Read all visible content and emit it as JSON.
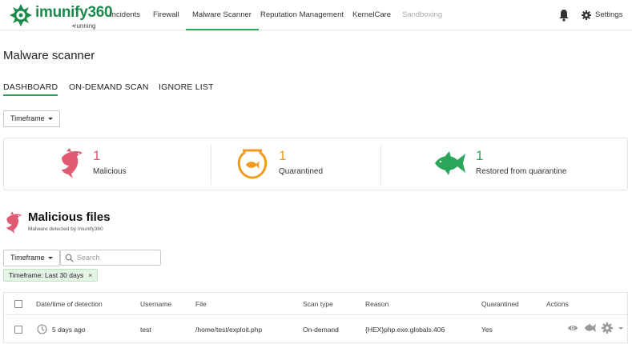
{
  "app": {
    "logo_text": "imunify360",
    "status": "•running"
  },
  "nav": {
    "items": [
      {
        "label": "Incidents",
        "state": "normal"
      },
      {
        "label": "Firewall",
        "state": "normal"
      },
      {
        "label": "Malware Scanner",
        "state": "active"
      },
      {
        "label": "Reputation Management",
        "state": "normal"
      },
      {
        "label": "KernelCare",
        "state": "normal"
      },
      {
        "label": "Sandboxing",
        "state": "disabled"
      }
    ],
    "notifications_icon": "bell-icon",
    "settings_label": "Settings"
  },
  "page": {
    "title": "Malware scanner",
    "tabs": [
      {
        "label": "DASHBOARD",
        "active": true
      },
      {
        "label": "ON-DEMAND SCAN",
        "active": false
      },
      {
        "label": "IGNORE LIST",
        "active": false
      }
    ]
  },
  "dashboard": {
    "timeframe_label": "Timeframe",
    "stats": [
      {
        "value": "1",
        "label": "Malicious",
        "icon": "shark-icon",
        "color": "#e05a72"
      },
      {
        "value": "1",
        "label": "Quarantined",
        "icon": "fishbowl-icon",
        "color": "#f29a1f"
      },
      {
        "value": "1",
        "label": "Restored from quarantine",
        "icon": "fish-icon",
        "color": "#2aa65a"
      }
    ]
  },
  "malicious_files": {
    "title": "Malicious files",
    "subtitle": "Malware detected by Imunify360",
    "timeframe_label": "Timeframe",
    "search_placeholder": "Search",
    "filter_chip": "Timeframe: Last 30 days",
    "filter_chip_close": "×",
    "columns": [
      "Date/time of detection",
      "Username",
      "File",
      "Scan type",
      "Reason",
      "Quarantined",
      "Actions"
    ],
    "rows": [
      {
        "date": "5 days ago",
        "username": "test",
        "file": "/home/test/exploit.php",
        "scan_type": "On-demand",
        "reason": "{HEX}php.exe.globals.406",
        "quarantined": "Yes"
      }
    ]
  },
  "colors": {
    "accent": "#2aa65a",
    "malicious": "#e05a72",
    "quarantined": "#f29a1f"
  }
}
